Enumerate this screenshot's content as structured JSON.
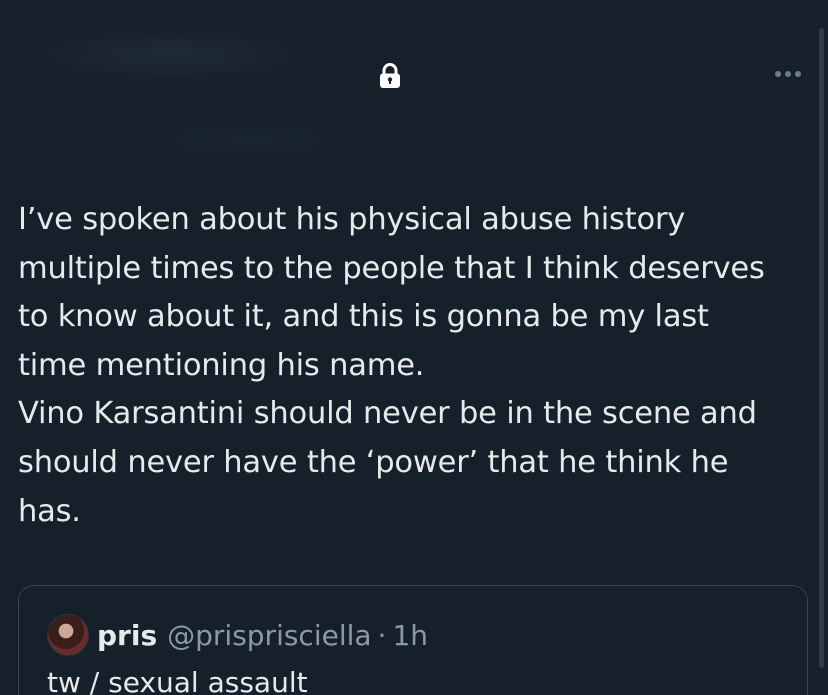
{
  "header": {
    "lock_icon": "lock-icon",
    "more_icon": "more-options-icon"
  },
  "tweet": {
    "lines": [
      "I’ve spoken about his physical abuse history",
      "multiple times to the people that I think deserves",
      "to know about it, and this is gonna be my last",
      "time mentioning his name.",
      "Vino Karsantini should never be in the scene and",
      "should never have the ‘power’ that he think he",
      "has."
    ]
  },
  "quote": {
    "display_name": "pris",
    "handle": "@prisprisciella",
    "separator": "·",
    "time": "1h",
    "text": "tw / sexual assault"
  },
  "colors": {
    "background": "#15202b",
    "text": "#e7e9ea",
    "muted": "#8b98a5",
    "border": "#38444d"
  }
}
